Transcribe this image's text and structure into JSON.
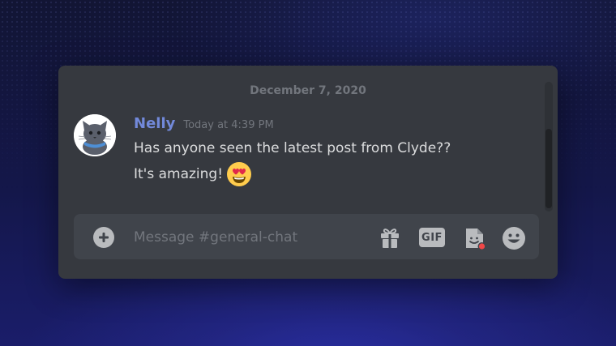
{
  "chat": {
    "date_divider": "December 7, 2020",
    "message": {
      "username": "Nelly",
      "timestamp": "Today at 4:39 PM",
      "line1": "Has anyone seen the latest post from Clyde??",
      "line2": "It's amazing!",
      "emoji": "heart-eyes-emoji"
    }
  },
  "composer": {
    "placeholder": "Message #general-chat",
    "value": "",
    "gif_label": "GIF",
    "icons": [
      "plus-circle-icon",
      "gift-icon",
      "gif-icon",
      "sticker-icon",
      "emoji-smile-icon"
    ]
  },
  "colors": {
    "username": "#7289da",
    "window_bg": "#36393f",
    "input_bg": "#40444b",
    "notification_dot": "#f04747"
  }
}
